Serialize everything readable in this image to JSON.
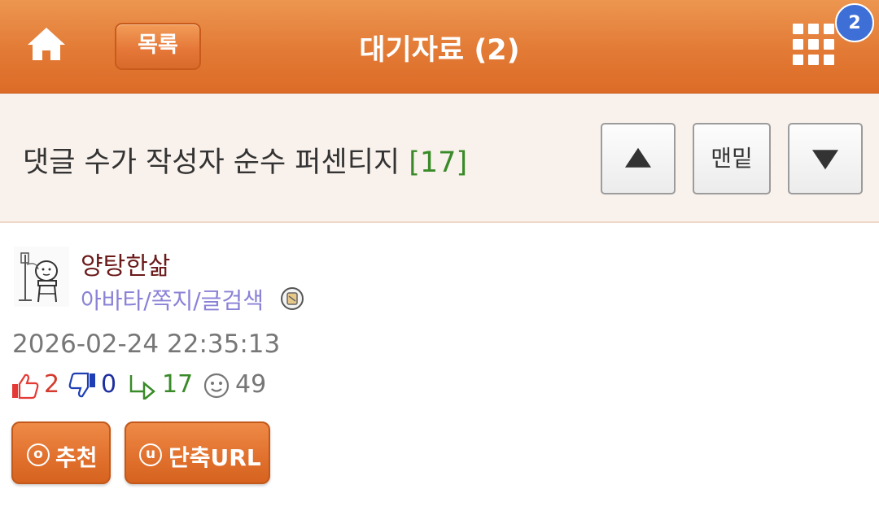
{
  "header": {
    "title": "대기자료 (2)",
    "list_label": "목록",
    "notification_count": "2",
    "accent_color": "#e27a35"
  },
  "post": {
    "title": "댓글 수가 작성자 순수 퍼센티지",
    "comment_count": "[17]",
    "nav_bottom_label": "맨밑"
  },
  "author": {
    "name": "양탕한삶",
    "links": "아바타/쪽지/글검색",
    "date": "2026-02-24 22:35:13"
  },
  "stats": {
    "likes": "2",
    "dislikes": "0",
    "replies": "17",
    "views": "49"
  },
  "actions": {
    "recommend_label": "추천",
    "short_url_label": "단축URL",
    "recommend_icon_letter": "o",
    "short_url_icon_letter": "u"
  }
}
